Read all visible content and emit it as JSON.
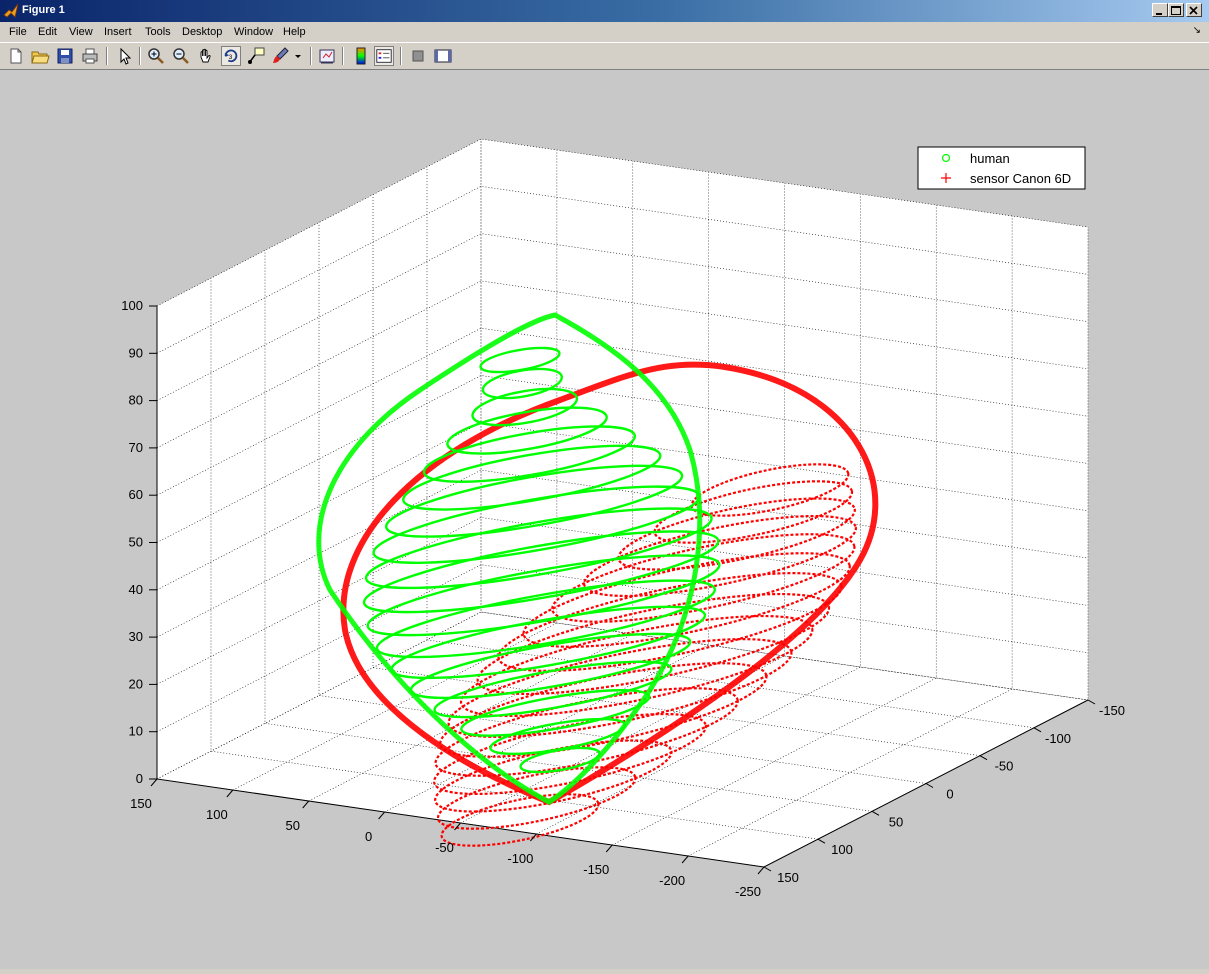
{
  "window": {
    "title": "Figure 1"
  },
  "menu": [
    "File",
    "Edit",
    "View",
    "Insert",
    "Tools",
    "Desktop",
    "Window",
    "Help"
  ],
  "toolbar": {
    "icons": [
      "new-figure-icon",
      "open-file-icon",
      "save-icon",
      "print-icon",
      "edit-plot-arrow-icon",
      "zoom-in-icon",
      "zoom-out-icon",
      "pan-hand-icon",
      "rotate-3d-icon",
      "data-cursor-icon",
      "brush-icon",
      "brush-dropdown-icon",
      "link-plot-icon",
      "colorbar-icon",
      "legend-icon",
      "hide-plot-tools-icon",
      "show-plot-tools-icon"
    ]
  },
  "colors": {
    "human": "#00ff00",
    "sensor": "#ff0000",
    "window_bg": "#d4d0c8",
    "figure_bg": "#c8c8c8",
    "axes_bg": "#ffffff"
  },
  "chart_data": {
    "type": "scatter",
    "view": "3d",
    "grid": true,
    "legend_position": "top-right",
    "zlim": [
      0,
      100
    ],
    "z_ticks": [
      "0",
      "10",
      "20",
      "30",
      "40",
      "50",
      "60",
      "70",
      "80",
      "90",
      "100"
    ],
    "xlim": [
      -250,
      150
    ],
    "x_ticks": [
      "150",
      "100",
      "50",
      "0",
      "-50",
      "-100",
      "-150",
      "-200",
      "-250"
    ],
    "ylim": [
      -150,
      150
    ],
    "y_ticks": [
      "150",
      "100",
      "50",
      "0",
      "-50",
      "-100",
      "-150"
    ],
    "series": [
      {
        "name": "human",
        "marker": "o",
        "color": "#00ff00"
      },
      {
        "name": "sensor Canon 6D",
        "marker": "+",
        "color": "#ff0000"
      }
    ]
  }
}
